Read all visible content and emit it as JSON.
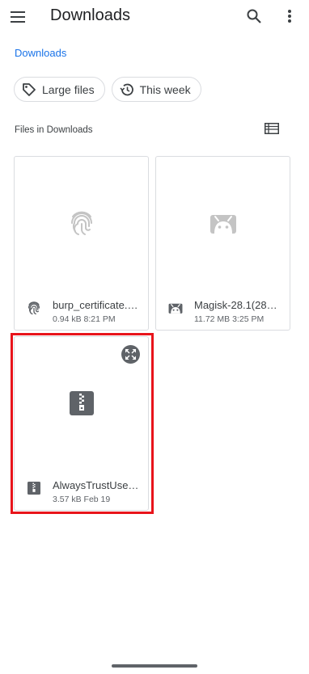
{
  "app": {
    "title": "Downloads"
  },
  "breadcrumb": {
    "label": "Downloads"
  },
  "chips": [
    {
      "label": "Large files",
      "icon": "label-tag-icon"
    },
    {
      "label": "This week",
      "icon": "history-icon"
    }
  ],
  "section": {
    "label": "Files in Downloads"
  },
  "files": [
    {
      "name": "burp_certificate.…",
      "size": "0.94 kB",
      "time": "8:21 PM",
      "icon": "fingerprint-icon"
    },
    {
      "name": "Magisk-28.1(28…",
      "size": "11.72 MB",
      "time": "3:25 PM",
      "icon": "android-icon"
    },
    {
      "name": "AlwaysTrustUse…",
      "size": "3.57 kB",
      "time": "Feb 19",
      "icon": "zip-archive-icon"
    }
  ],
  "colors": {
    "accent": "#1a73e8",
    "highlight": "#e8141b",
    "icon_grey": "#5f6368",
    "thumb_grey": "#c4c4c4"
  }
}
